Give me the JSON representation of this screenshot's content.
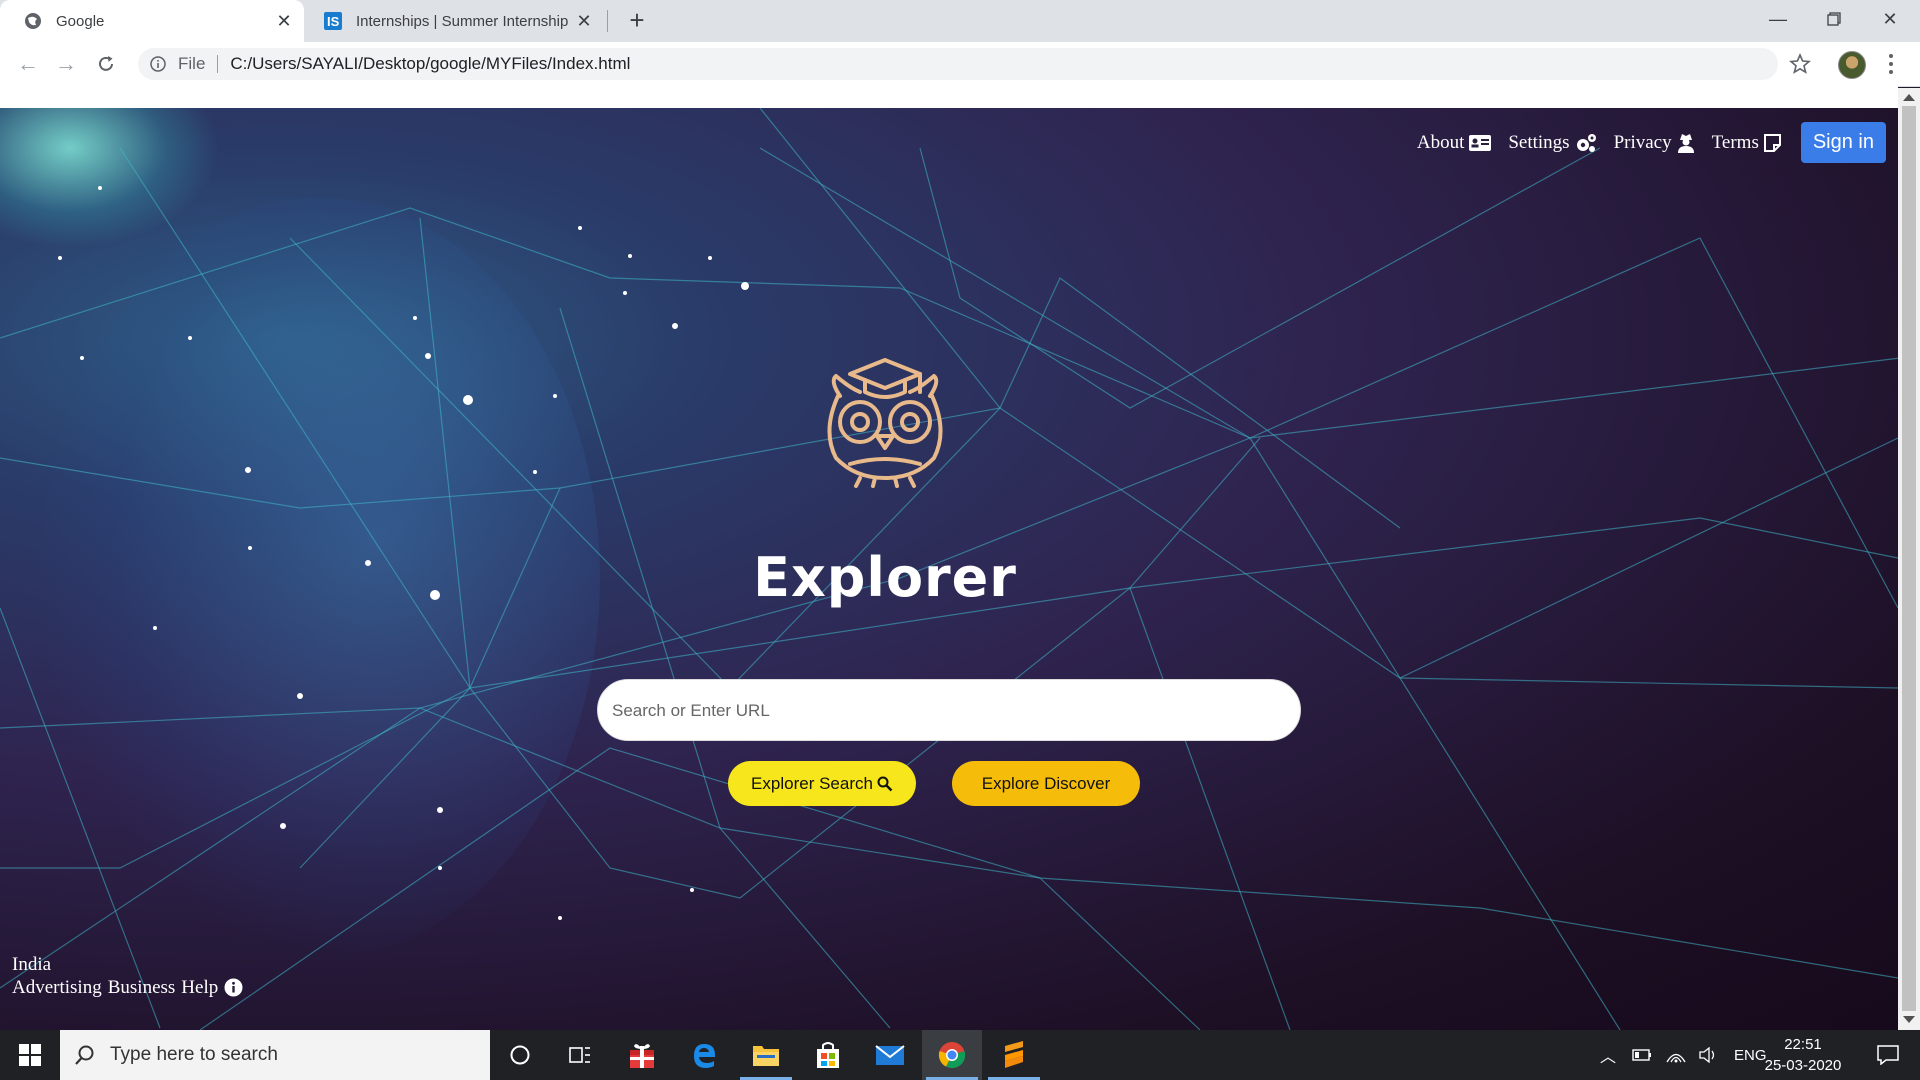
{
  "browser": {
    "tabs": [
      {
        "title": "Google",
        "active": true
      },
      {
        "title": "Internships | Summer Internship",
        "active": false
      }
    ],
    "address": {
      "scheme": "File",
      "url": "C:/Users/SAYALI/Desktop/google/MYFiles/Index.html"
    }
  },
  "nav": {
    "about": "About",
    "settings": "Settings",
    "privacy": "Privacy",
    "terms": "Terms",
    "signin": "Sign in"
  },
  "brand": {
    "name": "Explorer"
  },
  "search": {
    "placeholder": "Search or Enter URL",
    "value": ""
  },
  "buttons": {
    "search": "Explorer Search",
    "discover": "Explore Discover"
  },
  "footer": {
    "country": "India",
    "advertising": "Advertising",
    "business": "Business",
    "help": "Help"
  },
  "taskbar": {
    "search_placeholder": "Type here to search",
    "lang": "ENG",
    "time": "22:51",
    "date": "25-03-2020"
  },
  "colors": {
    "signin": "#3b7de8",
    "btn_search": "#f6e61b",
    "btn_discover": "#f5bd0a"
  }
}
